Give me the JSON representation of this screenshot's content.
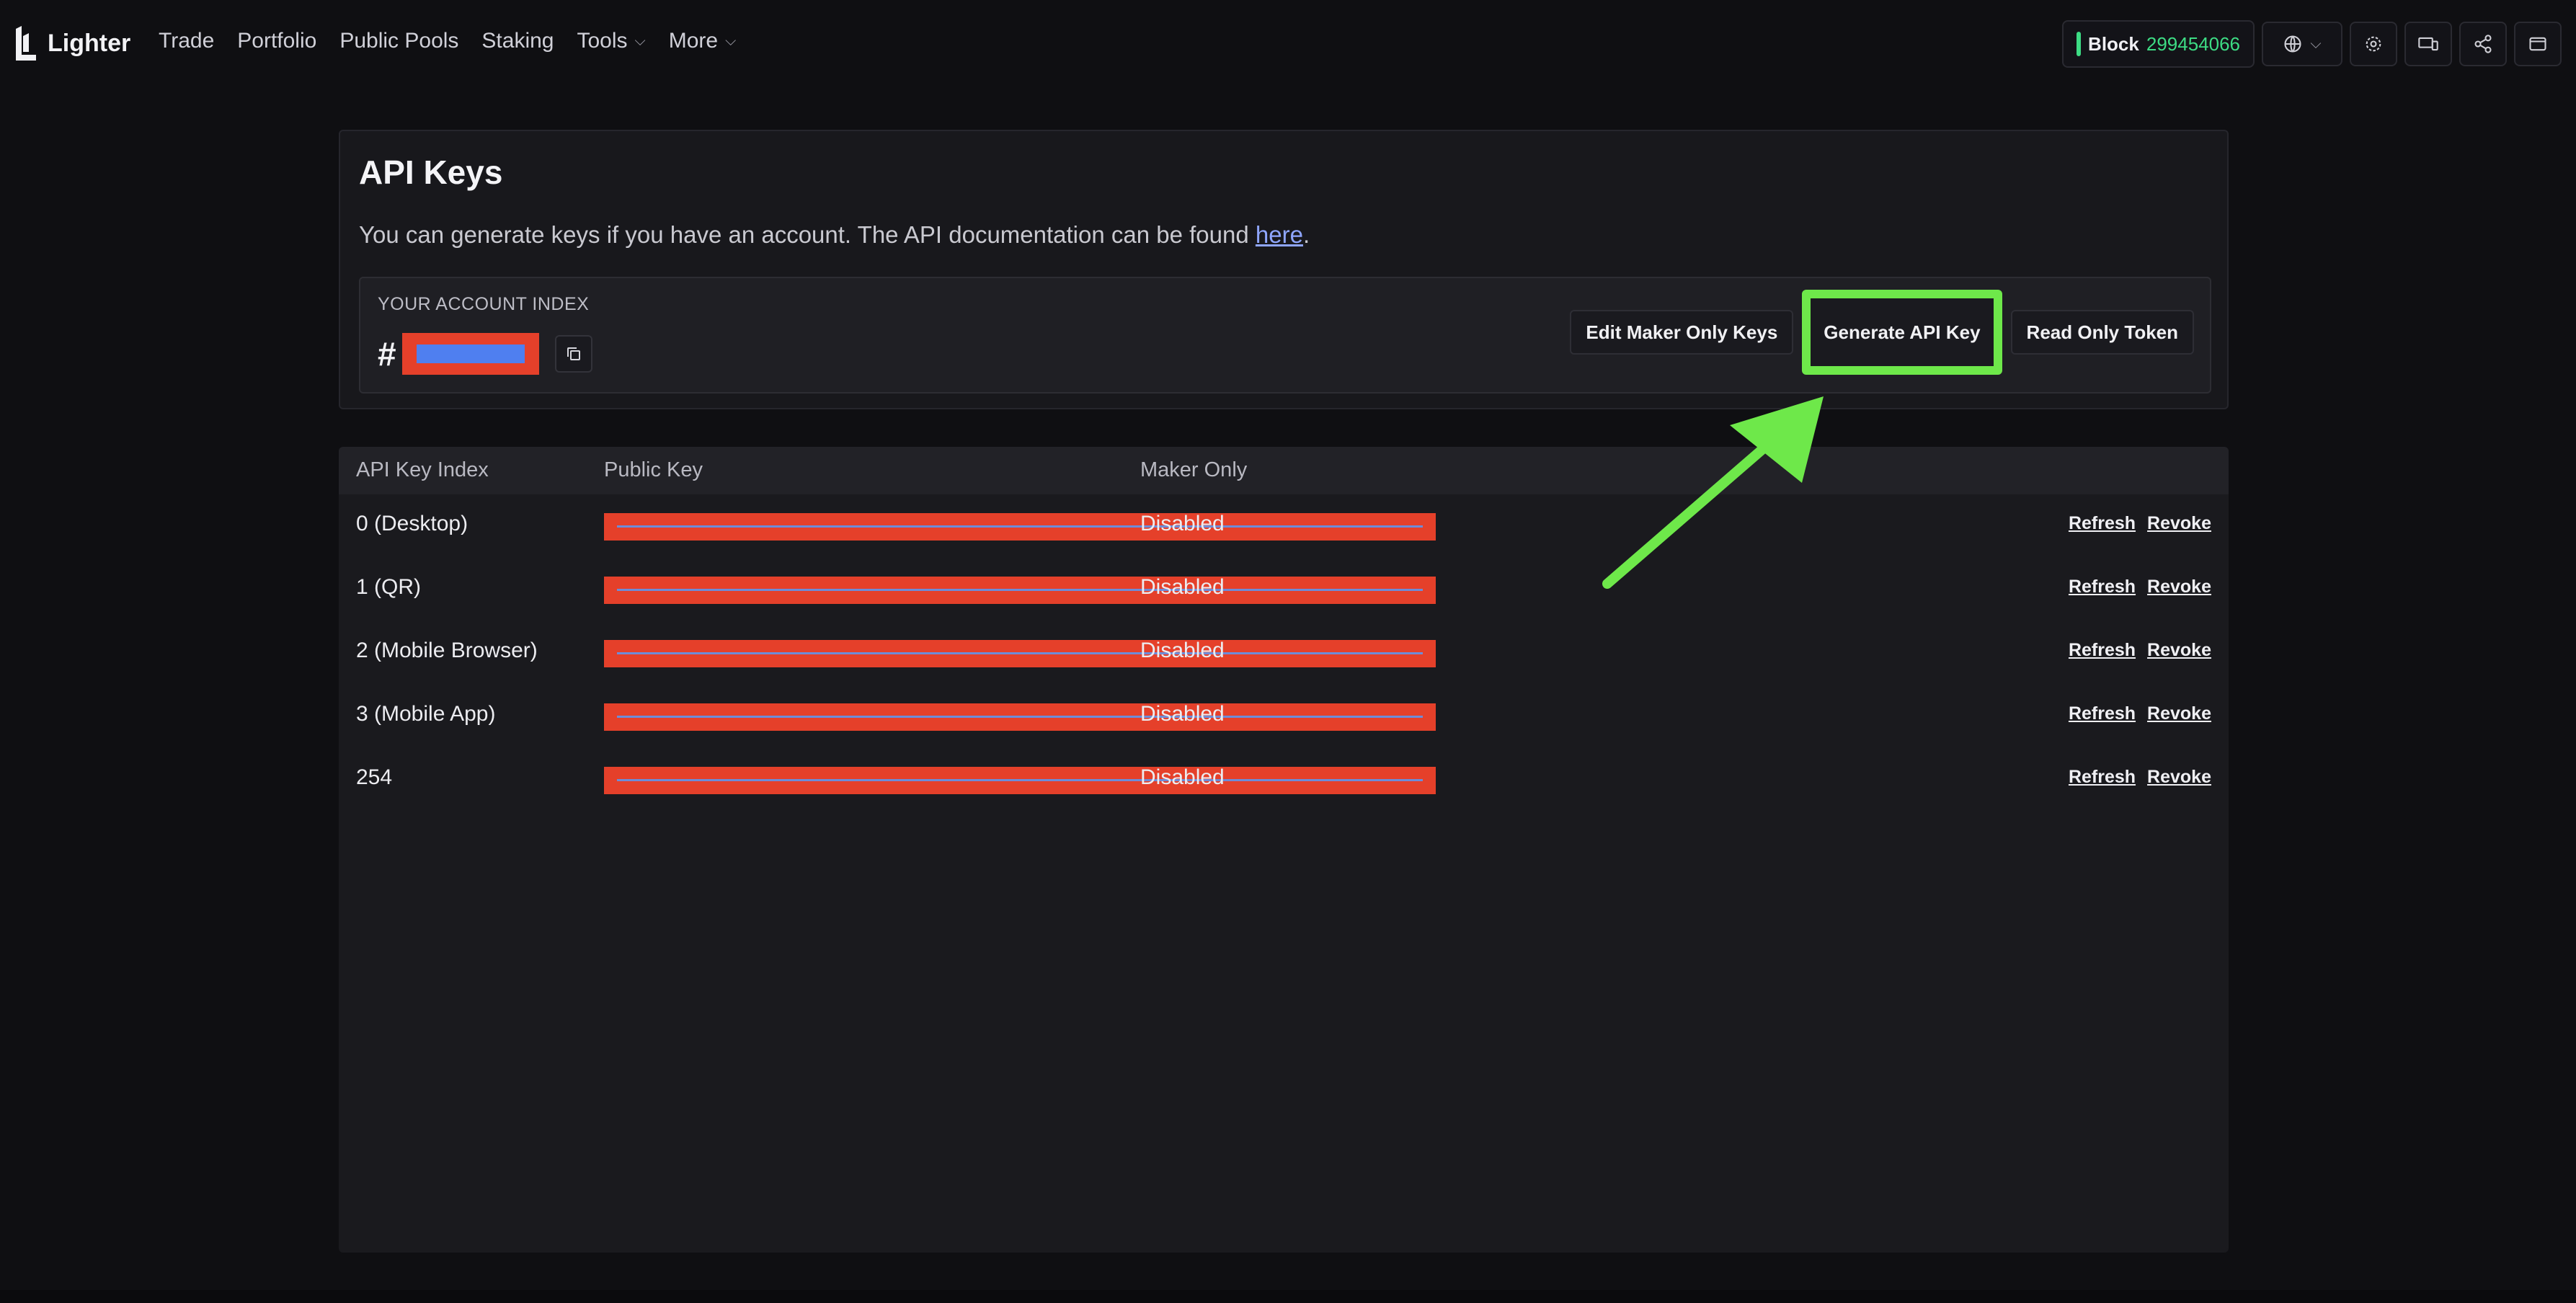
{
  "app": {
    "name": "Lighter"
  },
  "nav": [
    {
      "label": "Trade",
      "has_menu": false
    },
    {
      "label": "Portfolio",
      "has_menu": false
    },
    {
      "label": "Public Pools",
      "has_menu": false
    },
    {
      "label": "Staking",
      "has_menu": false
    },
    {
      "label": "Tools",
      "has_menu": true
    },
    {
      "label": "More",
      "has_menu": true
    }
  ],
  "header": {
    "block_label": "Block",
    "block_number": "299454066",
    "icons": [
      "globe-icon",
      "settings-icon",
      "devices-icon",
      "share-icon",
      "wallet-icon"
    ]
  },
  "api_keys": {
    "title": "API Keys",
    "description_prefix": "You can generate keys if you have an account. The API documentation can be found ",
    "description_link": "here",
    "description_suffix": ".",
    "account_label": "YOUR ACCOUNT INDEX",
    "account_hash": "#",
    "buttons": {
      "edit_maker": "Edit Maker Only Keys",
      "generate": "Generate API Key",
      "read_only": "Read Only Token"
    }
  },
  "table": {
    "headers": {
      "index": "API Key Index",
      "public_key": "Public Key",
      "maker_only": "Maker Only"
    },
    "rows": [
      {
        "index": "0 (Desktop)",
        "maker_only": "Disabled",
        "refresh": "Refresh",
        "revoke": "Revoke"
      },
      {
        "index": "1 (QR)",
        "maker_only": "Disabled",
        "refresh": "Refresh",
        "revoke": "Revoke"
      },
      {
        "index": "2 (Mobile Browser)",
        "maker_only": "Disabled",
        "refresh": "Refresh",
        "revoke": "Revoke"
      },
      {
        "index": "3 (Mobile App)",
        "maker_only": "Disabled",
        "refresh": "Refresh",
        "revoke": "Revoke"
      },
      {
        "index": "254",
        "maker_only": "Disabled",
        "refresh": "Refresh",
        "revoke": "Revoke"
      }
    ]
  },
  "colors": {
    "accent_green": "#3ddc84",
    "highlight_green": "#6ee84a",
    "redaction_red": "#e5402a",
    "redaction_blue": "#4f7ff0",
    "link_blue": "#8fa6ff"
  }
}
